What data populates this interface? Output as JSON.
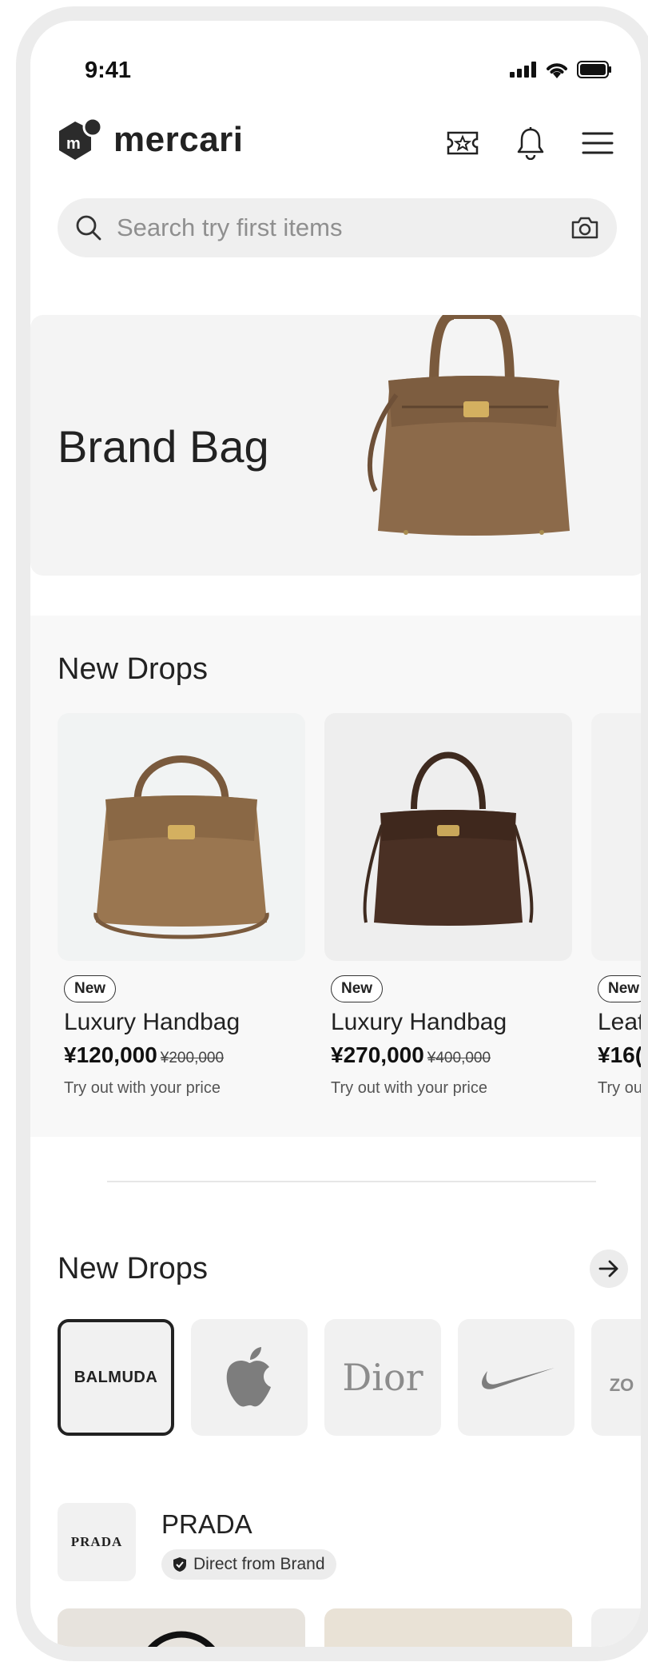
{
  "status_bar": {
    "time": "9:41"
  },
  "header": {
    "logo_text": "mercari",
    "icons": [
      "ticket-icon",
      "bell-icon",
      "menu-icon"
    ]
  },
  "search": {
    "placeholder": "Search try first items",
    "icons": [
      "search-icon",
      "camera-icon"
    ]
  },
  "hero": {
    "title": "Brand Bag"
  },
  "new_drops": {
    "title": "New Drops",
    "items": [
      {
        "badge": "New",
        "name": "Luxury Handbag",
        "price": "¥120,000",
        "old_price": "¥200,000",
        "note": "Try out with your price"
      },
      {
        "badge": "New",
        "name": "Luxury Handbag",
        "price": "¥270,000",
        "old_price": "¥400,000",
        "note": "Try out with your price"
      },
      {
        "badge": "New",
        "name": "Leat",
        "price": "¥16(",
        "note": "Try ou"
      }
    ]
  },
  "brands_section": {
    "title": "New Drops",
    "brands": [
      {
        "label": "BALMUDA",
        "selected": true
      },
      {
        "icon": "apple-logo-icon"
      },
      {
        "label": "Dior"
      },
      {
        "icon": "nike-swoosh-icon"
      },
      {
        "label": "ZO"
      }
    ]
  },
  "featured_brand": {
    "logo_text": "PRADA",
    "name": "PRADA",
    "tag": "Direct from Brand"
  },
  "colors": {
    "hero_bg": "#f4f4f4",
    "bag_tan": "#8c6a4a",
    "bag_dark": "#4a3024"
  }
}
